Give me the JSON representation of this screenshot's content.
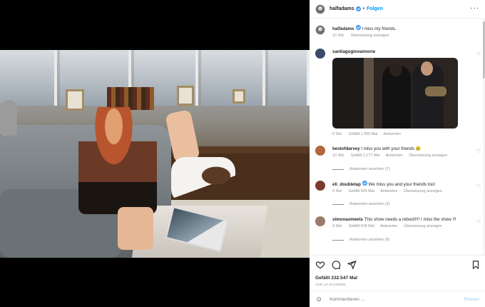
{
  "post": {
    "username": "halfadams",
    "follow_label": "Folgen",
    "more_label": "···",
    "caption_user": "halfadams",
    "caption_text": "I miss my friends.",
    "caption_time": "10 Std.",
    "caption_translate": "Übersetzung anzeigen"
  },
  "comments": [
    {
      "user": "santiagogiovannone",
      "text": "",
      "time": "9 Std.",
      "likes": "Gefällt 1.250 Mal",
      "reply": "Antworten",
      "translate": "",
      "view_replies": "",
      "avatar_color": "#3a4a6a"
    },
    {
      "user": "bestofdarvey",
      "text": "I miss you with your friends 😢",
      "time": "10 Std.",
      "likes": "Gefällt 1.177 Mal",
      "reply": "Antworten",
      "translate": "Übersetzung anzeigen",
      "view_replies": "Antworten ansehen (7)",
      "avatar_color": "#b2663c"
    },
    {
      "user": "eli_doubletap",
      "text": "We miss you and your friends too!",
      "time": "9 Std.",
      "likes": "Gefällt 526 Mal",
      "reply": "Antworten",
      "translate": "Übersetzung anzeigen",
      "view_replies": "Antworten ansehen (2)",
      "avatar_color": "#7a3b2e"
    },
    {
      "user": "simonasmeets",
      "text": "This show needs a reboot!!!! I miss the show !!!",
      "time": "9 Std.",
      "likes": "Gefällt 418 Mal",
      "reply": "Antworten",
      "translate": "Übersetzung anzeigen",
      "view_replies": "Antworten ansehen (6)",
      "avatar_color": "#9a7b6a"
    }
  ],
  "actions": {
    "likes": "Gefällt 232.547 Mal",
    "time": "VOR 10 STUNDEN",
    "comment_placeholder": "Kommentieren ...",
    "post_label": "Posten"
  },
  "colors": {
    "accent": "#0095f6",
    "verified": "#3897f0",
    "muted": "#8e8e8e",
    "post_disabled": "#b3dbff"
  },
  "icons": {
    "heart": "heart-icon",
    "comment": "comment-icon",
    "share": "share-icon",
    "bookmark": "bookmark-icon",
    "emoji": "emoji-icon"
  }
}
